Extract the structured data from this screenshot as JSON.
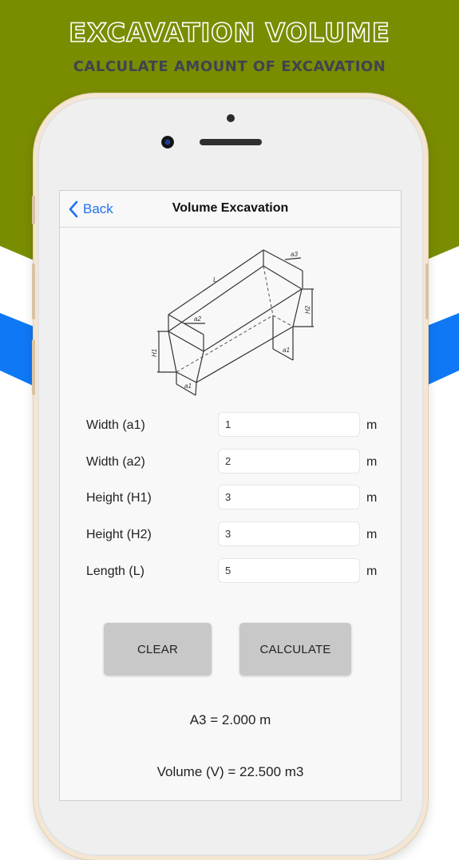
{
  "promo": {
    "headline": "EXCAVATION VOLUME",
    "subheadline": "CALCULATE AMOUNT OF EXCAVATION",
    "colors": {
      "green": "#7a8c00",
      "blue": "#0f78f5",
      "subhead_text": "#3f4450"
    }
  },
  "app": {
    "navbar": {
      "back_label": "Back",
      "back_icon": "chevron-left-icon",
      "title": "Volume Excavation",
      "accent": "#1f72f2"
    },
    "diagram": {
      "description": "Trapezoidal excavation isometric sketch",
      "labels": {
        "length": "L",
        "a1": "a1",
        "a2": "a2",
        "a3": "a3",
        "h1": "H1",
        "h2": "H2"
      }
    },
    "form": {
      "fields": [
        {
          "label": "Width (a1)",
          "value": "1",
          "unit": "m"
        },
        {
          "label": "Width (a2)",
          "value": "2",
          "unit": "m"
        },
        {
          "label": "Height (H1)",
          "value": "3",
          "unit": "m"
        },
        {
          "label": "Height (H2)",
          "value": "3",
          "unit": "m"
        },
        {
          "label": "Length (L)",
          "value": "5",
          "unit": "m"
        }
      ]
    },
    "buttons": {
      "clear_label": "CLEAR",
      "calculate_label": "CALCULATE"
    },
    "results": {
      "a3": "A3 = 2.000 m",
      "volume": "Volume (V) = 22.500 m3"
    }
  }
}
